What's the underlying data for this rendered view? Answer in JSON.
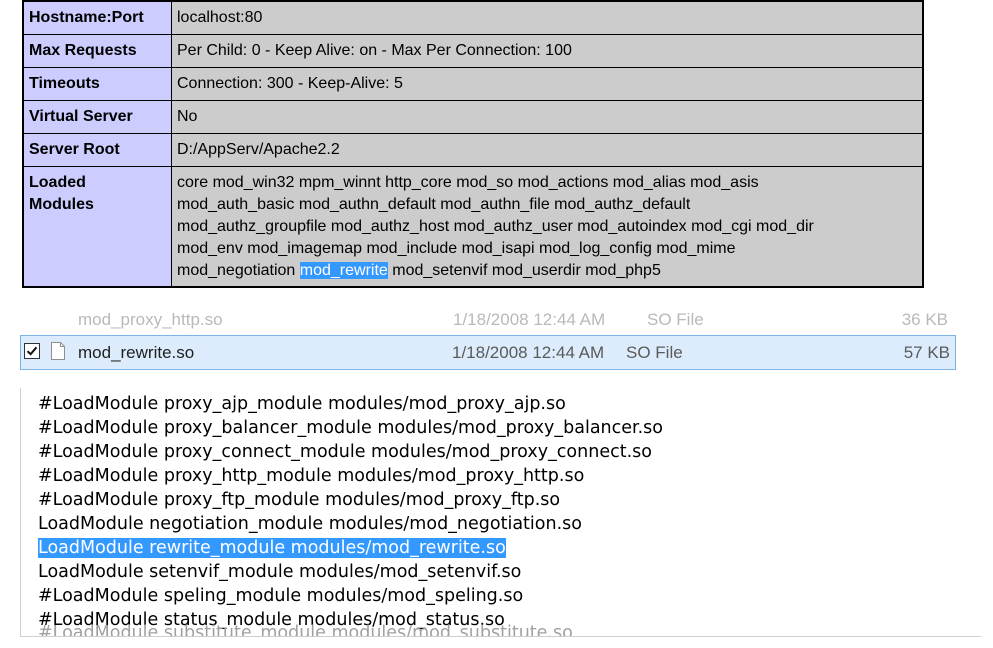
{
  "phpinfo": {
    "rows": [
      {
        "key": "Hostname:Port",
        "value": "localhost:80"
      },
      {
        "key": "Max Requests",
        "value": "Per Child: 0 - Keep Alive: on - Max Per Connection: 100"
      },
      {
        "key": "Timeouts",
        "value": "Connection: 300 - Keep-Alive: 5"
      },
      {
        "key": "Virtual Server",
        "value": "No"
      },
      {
        "key": "Server Root",
        "value": "D:/AppServ/Apache2.2"
      }
    ],
    "loaded_modules": {
      "key_line1": "Loaded",
      "key_line2": "Modules",
      "line1": "core mod_win32 mpm_winnt http_core mod_so mod_actions mod_alias mod_asis",
      "line2": "mod_auth_basic mod_authn_default mod_authn_file mod_authz_default",
      "line3": "mod_authz_groupfile mod_authz_host mod_authz_user mod_autoindex mod_cgi mod_dir",
      "line4": "mod_env mod_imagemap mod_include mod_isapi mod_log_config mod_mime",
      "line5_before": "mod_negotiation ",
      "line5_selected": "mod_rewrite",
      "line5_after": " mod_setenvif mod_userdir mod_php5"
    }
  },
  "explorer": {
    "ghost_row": {
      "name": "mod_proxy_http.so",
      "date": "1/18/2008 12:44 AM",
      "type": "SO File",
      "size": "36 KB"
    },
    "selected_row": {
      "checked": true,
      "name": "mod_rewrite.so",
      "date": "1/18/2008 12:44 AM",
      "type": "SO File",
      "size": "57 KB"
    },
    "colors": {
      "selection_bg": "#dcecfc",
      "selection_border": "#7eb4ea"
    }
  },
  "editor": {
    "lines": [
      "#LoadModule proxy_ajp_module modules/mod_proxy_ajp.so",
      "#LoadModule proxy_balancer_module modules/mod_proxy_balancer.so",
      "#LoadModule proxy_connect_module modules/mod_proxy_connect.so",
      "#LoadModule proxy_http_module modules/mod_proxy_http.so",
      "#LoadModule proxy_ftp_module modules/mod_proxy_ftp.so",
      "LoadModule negotiation_module modules/mod_negotiation.so",
      "LoadModule rewrite_module modules/mod_rewrite.so",
      "LoadModule setenvif_module modules/mod_setenvif.so",
      "#LoadModule speling_module modules/mod_speling.so",
      "#LoadModule status_module modules/mod_status.so"
    ],
    "highlighted_line_index": 6,
    "ghost_line": "#LoadModule substitute_module modules/mod_substitute.so",
    "colors": {
      "highlight_bg": "#3399ff",
      "highlight_text": "#ffffff"
    }
  }
}
